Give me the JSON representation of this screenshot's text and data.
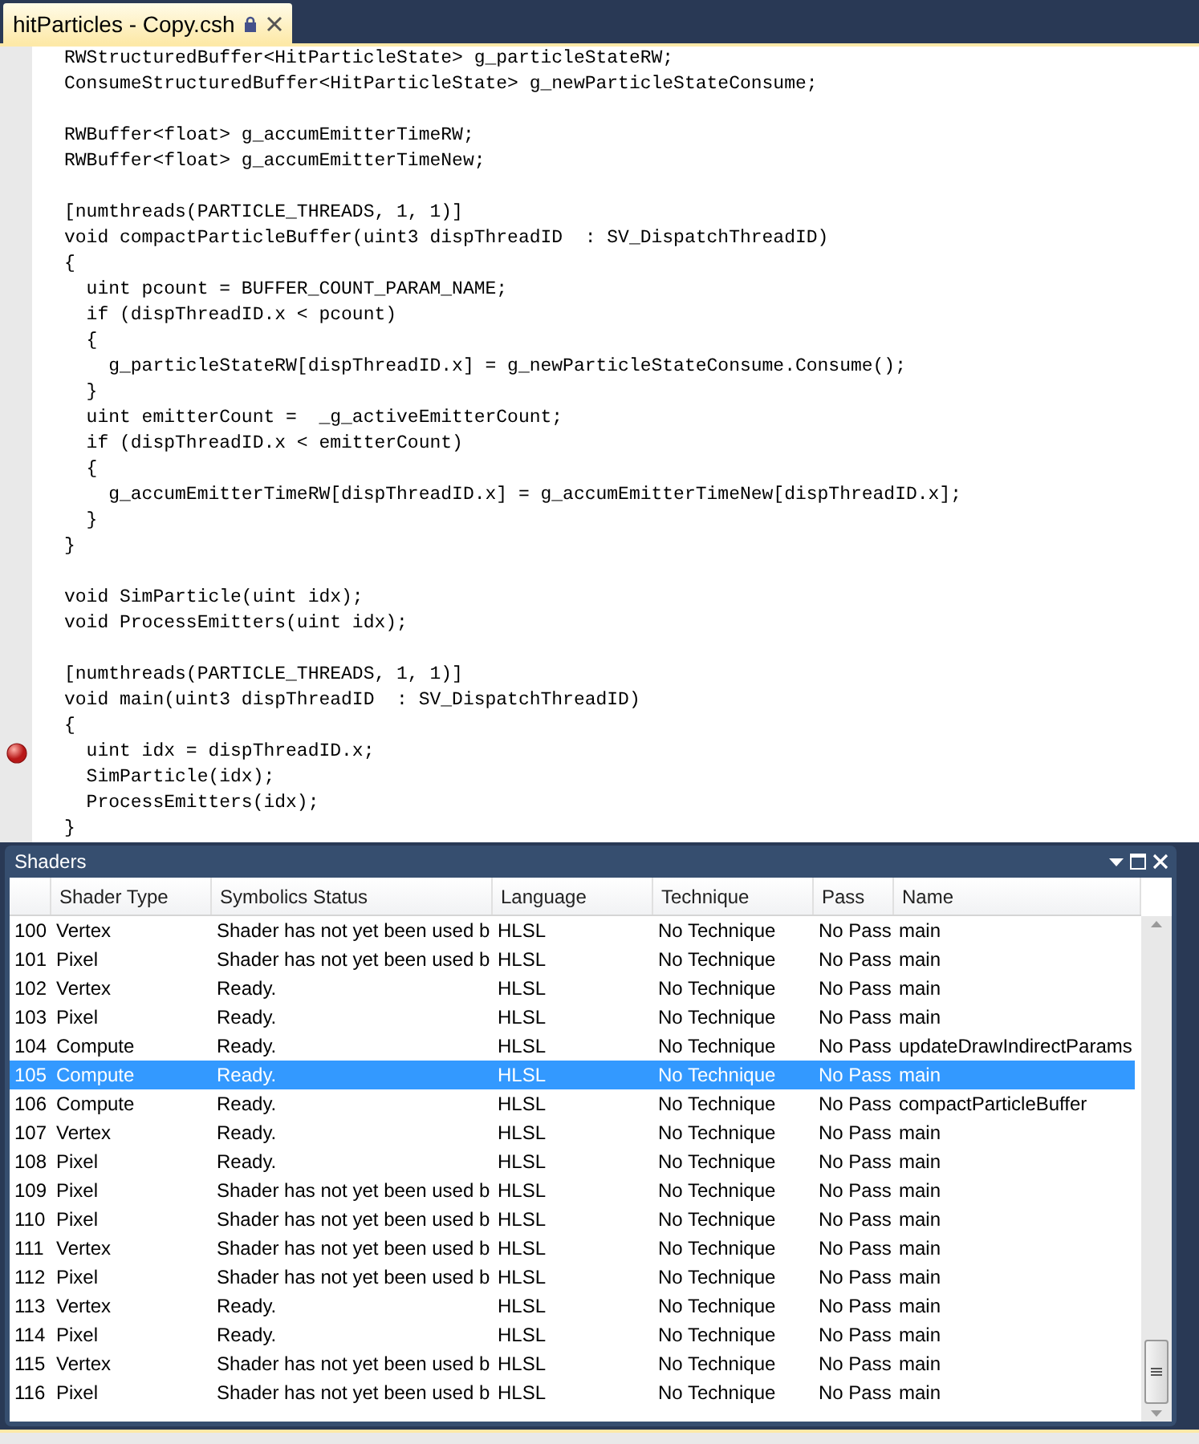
{
  "tab": {
    "title": "hitParticles - Copy.csh",
    "locked": true,
    "selected": true
  },
  "code": [
    {
      "kind": "code",
      "text": "RWStructuredBuffer<HitParticleState> g_particleStateRW;",
      "breakpoint": false
    },
    {
      "kind": "code",
      "text": "ConsumeStructuredBuffer<HitParticleState> g_newParticleStateConsume;",
      "breakpoint": false
    },
    {
      "kind": "blank"
    },
    {
      "kind": "code",
      "text": "RWBuffer<float> g_accumEmitterTimeRW;",
      "breakpoint": false
    },
    {
      "kind": "code",
      "text": "RWBuffer<float> g_accumEmitterTimeNew;",
      "breakpoint": false
    },
    {
      "kind": "blank"
    },
    {
      "kind": "code",
      "text": "[numthreads(PARTICLE_THREADS, 1, 1)]",
      "breakpoint": false
    },
    {
      "kind": "code",
      "text": "void compactParticleBuffer(uint3 dispThreadID  : SV_DispatchThreadID)",
      "breakpoint": false
    },
    {
      "kind": "code",
      "text": "{",
      "breakpoint": false
    },
    {
      "kind": "code",
      "text": "  uint pcount = BUFFER_COUNT_PARAM_NAME;",
      "breakpoint": false
    },
    {
      "kind": "code",
      "text": "  if (dispThreadID.x < pcount)",
      "breakpoint": false
    },
    {
      "kind": "code",
      "text": "  {",
      "breakpoint": false
    },
    {
      "kind": "code",
      "text": "    g_particleStateRW[dispThreadID.x] = g_newParticleStateConsume.Consume();",
      "breakpoint": false
    },
    {
      "kind": "code",
      "text": "  }",
      "breakpoint": false
    },
    {
      "kind": "code",
      "text": "  uint emitterCount =  _g_activeEmitterCount;",
      "breakpoint": false
    },
    {
      "kind": "code",
      "text": "  if (dispThreadID.x < emitterCount)",
      "breakpoint": false
    },
    {
      "kind": "code",
      "text": "  {",
      "breakpoint": false
    },
    {
      "kind": "code",
      "text": "    g_accumEmitterTimeRW[dispThreadID.x] = g_accumEmitterTimeNew[dispThreadID.x];",
      "breakpoint": false
    },
    {
      "kind": "code",
      "text": "  }",
      "breakpoint": false
    },
    {
      "kind": "code",
      "text": "}",
      "breakpoint": false
    },
    {
      "kind": "blank"
    },
    {
      "kind": "code",
      "text": "void SimParticle(uint idx);",
      "breakpoint": false
    },
    {
      "kind": "code",
      "text": "void ProcessEmitters(uint idx);",
      "breakpoint": false
    },
    {
      "kind": "blank"
    },
    {
      "kind": "code",
      "text": "[numthreads(PARTICLE_THREADS, 1, 1)]",
      "breakpoint": false
    },
    {
      "kind": "code",
      "text": "void main(uint3 dispThreadID  : SV_DispatchThreadID)",
      "breakpoint": false
    },
    {
      "kind": "code",
      "text": "{",
      "breakpoint": false
    },
    {
      "kind": "code",
      "text": "  uint idx = dispThreadID.x;",
      "breakpoint": true
    },
    {
      "kind": "code",
      "text": "  SimParticle(idx);",
      "breakpoint": false
    },
    {
      "kind": "code",
      "text": "  ProcessEmitters(idx);",
      "breakpoint": false
    },
    {
      "kind": "code",
      "text": "}",
      "breakpoint": false
    }
  ],
  "panel": {
    "title": "Shaders",
    "columns": [
      "Shader Type",
      "Symbolics Status",
      "Language",
      "Technique",
      "Pass",
      "Name"
    ],
    "rows": [
      {
        "id": "100",
        "cells": [
          "Vertex",
          "Shader has not yet been used b",
          "HLSL",
          "No Technique",
          "No Pass",
          "main"
        ],
        "selected": false
      },
      {
        "id": "101",
        "cells": [
          "Pixel",
          "Shader has not yet been used b",
          "HLSL",
          "No Technique",
          "No Pass",
          "main"
        ],
        "selected": false
      },
      {
        "id": "102",
        "cells": [
          "Vertex",
          "Ready.",
          "HLSL",
          "No Technique",
          "No Pass",
          "main"
        ],
        "selected": false
      },
      {
        "id": "103",
        "cells": [
          "Pixel",
          "Ready.",
          "HLSL",
          "No Technique",
          "No Pass",
          "main"
        ],
        "selected": false
      },
      {
        "id": "104",
        "cells": [
          "Compute",
          "Ready.",
          "HLSL",
          "No Technique",
          "No Pass",
          "updateDrawIndirectParams"
        ],
        "selected": false
      },
      {
        "id": "105",
        "cells": [
          "Compute",
          "Ready.",
          "HLSL",
          "No Technique",
          "No Pass",
          "main"
        ],
        "selected": true
      },
      {
        "id": "106",
        "cells": [
          "Compute",
          "Ready.",
          "HLSL",
          "No Technique",
          "No Pass",
          "compactParticleBuffer"
        ],
        "selected": false
      },
      {
        "id": "107",
        "cells": [
          "Vertex",
          "Ready.",
          "HLSL",
          "No Technique",
          "No Pass",
          "main"
        ],
        "selected": false
      },
      {
        "id": "108",
        "cells": [
          "Pixel",
          "Ready.",
          "HLSL",
          "No Technique",
          "No Pass",
          "main"
        ],
        "selected": false
      },
      {
        "id": "109",
        "cells": [
          "Pixel",
          "Shader has not yet been used b",
          "HLSL",
          "No Technique",
          "No Pass",
          "main"
        ],
        "selected": false
      },
      {
        "id": "110",
        "cells": [
          "Pixel",
          "Shader has not yet been used b",
          "HLSL",
          "No Technique",
          "No Pass",
          "main"
        ],
        "selected": false
      },
      {
        "id": "111",
        "cells": [
          "Vertex",
          "Shader has not yet been used b",
          "HLSL",
          "No Technique",
          "No Pass",
          "main"
        ],
        "selected": false
      },
      {
        "id": "112",
        "cells": [
          "Pixel",
          "Shader has not yet been used b",
          "HLSL",
          "No Technique",
          "No Pass",
          "main"
        ],
        "selected": false
      },
      {
        "id": "113",
        "cells": [
          "Vertex",
          "Ready.",
          "HLSL",
          "No Technique",
          "No Pass",
          "main"
        ],
        "selected": false
      },
      {
        "id": "114",
        "cells": [
          "Pixel",
          "Ready.",
          "HLSL",
          "No Technique",
          "No Pass",
          "main"
        ],
        "selected": false
      },
      {
        "id": "115",
        "cells": [
          "Vertex",
          "Shader has not yet been used b",
          "HLSL",
          "No Technique",
          "No Pass",
          "main"
        ],
        "selected": false
      },
      {
        "id": "116",
        "cells": [
          "Pixel",
          "Shader has not yet been used b",
          "HLSL",
          "No Technique",
          "No Pass",
          "main"
        ],
        "selected": false
      }
    ]
  }
}
